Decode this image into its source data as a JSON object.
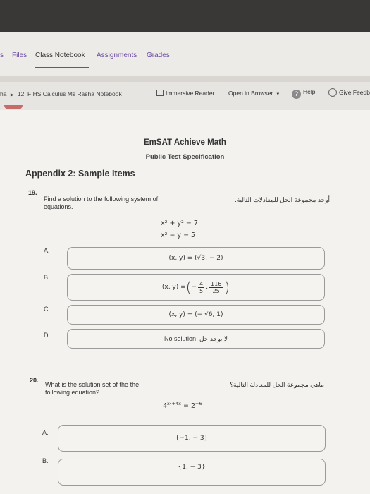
{
  "tabs": [
    "s",
    "Files",
    "Class Notebook",
    "Assignments",
    "Grades"
  ],
  "breadcrumb": {
    "prefix": "ha",
    "section": "12_F HS Calculus Ms Rasha Notebook"
  },
  "toolbar": {
    "immersive_reader": "Immersive Reader",
    "open_browser": "Open in Browser",
    "help": "Help",
    "feedback": "Give Feedb",
    "help_glyph": "?"
  },
  "doc": {
    "title": "EmSAT Achieve Math",
    "subtitle": "Public Test Specification",
    "appendix": "Appendix 2: Sample Items"
  },
  "q19": {
    "number": "19.",
    "text": "Find a solution to the following system of equations.",
    "arabic": "أوجد مجموعة الحل للمعادلات التالية.",
    "eq1": "x² + y² = 7",
    "eq2": "x² − y = 5",
    "options": [
      {
        "letter": "A.",
        "answer": "(x, y) = (√3, − 2)"
      },
      {
        "letter": "B.",
        "answer_prefix": "(x, y) =",
        "frac1_num": "4",
        "frac1_den": "5",
        "frac2_num": "116",
        "frac2_den": "25",
        "minus": "−"
      },
      {
        "letter": "C.",
        "answer": "(x, y) = (− √6, 1)"
      },
      {
        "letter": "D.",
        "answer": "No solution",
        "answer_arabic": "لا يوجد حل"
      }
    ]
  },
  "q20": {
    "number": "20.",
    "text": "What is the solution set of the the following equation?",
    "arabic": "ماهي مجموعة الحل للمعادلة التالية؟",
    "eq": "4^(x²+4x) = 2^(−6)",
    "eq_base": "4",
    "eq_exp": "x²+4x",
    "eq_rhs": "= 2",
    "eq_rhs_exp": "−6",
    "options": [
      {
        "letter": "A.",
        "answer": "{−1, − 3}"
      },
      {
        "letter": "B.",
        "answer": "{1, − 3}"
      }
    ]
  }
}
